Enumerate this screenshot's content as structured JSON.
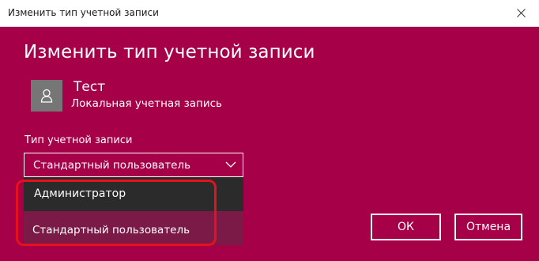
{
  "window": {
    "title": "Изменить тип учетной записи"
  },
  "heading": "Изменить тип учетной записи",
  "user": {
    "name": "Тест",
    "account_kind": "Локальная учетная запись",
    "avatar_icon": "user-icon"
  },
  "account_type": {
    "label": "Тип учетной записи",
    "selected": "Стандартный пользователь",
    "options": [
      "Администратор",
      "Стандартный пользователь"
    ]
  },
  "buttons": {
    "ok": "ОК",
    "cancel": "Отмена"
  },
  "colors": {
    "accent": "#a60049",
    "avatar_bg": "#767676",
    "option_hover": "#2b2b2b",
    "option_selected": "#7c1a47",
    "annotation": "#e8101d"
  }
}
